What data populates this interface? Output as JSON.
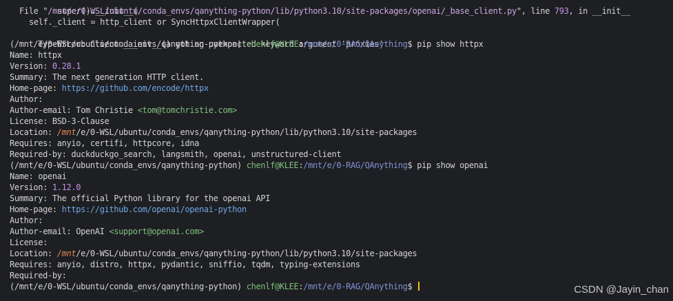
{
  "terminal": {
    "colors": {
      "background": "#1e1f22",
      "text": "#d4d4d4",
      "prompt_user_host": "#7fbf7f",
      "prompt_cwd": "#7f92d6",
      "version_number": "#c792ea",
      "url": "#6ea8e6",
      "email": "#7fbf7f",
      "italic_path": "#e08a53",
      "cursor": "#f0c419"
    },
    "traceback": {
      "line1": "super().__init__(",
      "line2_file_prefix": "File \"",
      "line2_file_path": "/mnt/e/0-WSL/ubuntu/conda_envs/qanything-python/lib/python3.10/site-packages/openai/_base_client.py",
      "line2_middle": "\", line ",
      "line2_line_number": "793",
      "line2_suffix": ", in __init__",
      "line3": "self._client = http_client or SyncHttpxClientWrapper(",
      "line3_paren": "(",
      "error": "TypeError: Client.__init__() got an unexpected keyword argument 'proxies'"
    },
    "prompt": {
      "env": "(/mnt/e/0-WSL/ubuntu/conda_envs/qanything-python)",
      "user_host": "chenlf@KLEE",
      "colon": ":",
      "cwd": "/mnt/e/0-RAG/QAnything",
      "dollar": "$"
    },
    "command1": "pip show httpx",
    "httpx": {
      "name_label": "Name:",
      "name": "httpx",
      "version_label": "Version:",
      "version": "0.28.1",
      "summary_label": "Summary:",
      "summary": "The next generation HTTP client.",
      "homepage_label": "Home-page:",
      "homepage": "https://github.com/encode/httpx",
      "author_label": "Author:",
      "author_email_label": "Author-email:",
      "author_email_name": "Tom Christie",
      "author_email": "<tom@tomchristie.com>",
      "license_label": "License:",
      "license": "BSD-3-Clause",
      "location_label": "Location:",
      "location_italic": "/mnt",
      "location_rest": "/e/0-WSL/ubuntu/conda_envs/qanything-python/lib/python3.10/site-packages",
      "requires_label": "Requires:",
      "requires": "anyio, certifi, httpcore, idna",
      "required_by_label": "Required-by:",
      "required_by": "duckduckgo_search, langsmith, openai, unstructured-client"
    },
    "command2": "pip show openai",
    "openai": {
      "name_label": "Name:",
      "name": "openai",
      "version_label": "Version:",
      "version": "1.12.0",
      "summary_label": "Summary:",
      "summary": "The official Python library for the openai API",
      "homepage_label": "Home-page:",
      "homepage": "https://github.com/openai/openai-python",
      "author_label": "Author:",
      "author_email_label": "Author-email:",
      "author_email_name": "OpenAI",
      "author_email": "<support@openai.com>",
      "license_label": "License:",
      "location_label": "Location:",
      "location_italic": "/mnt",
      "location_rest": "/e/0-WSL/ubuntu/conda_envs/qanything-python/lib/python3.10/site-packages",
      "requires_label": "Requires:",
      "requires": "anyio, distro, httpx, pydantic, sniffio, tqdm, typing-extensions",
      "required_by_label": "Required-by:"
    }
  },
  "watermark": "CSDN @Jayin_chan"
}
